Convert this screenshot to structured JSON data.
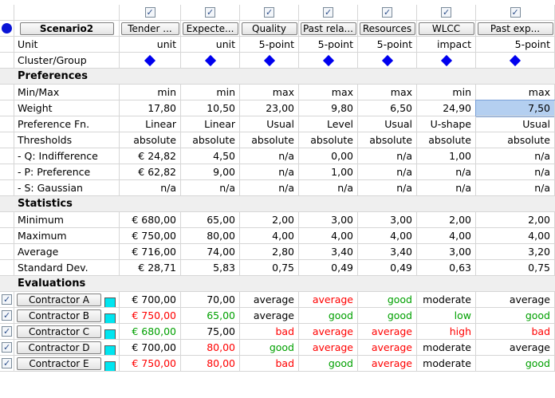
{
  "scenario": {
    "label": "Scenario2"
  },
  "criteria": [
    {
      "label": "Tender ...",
      "unit": "unit"
    },
    {
      "label": "Expecte...",
      "unit": "unit"
    },
    {
      "label": "Quality",
      "unit": "5-point"
    },
    {
      "label": "Past rela...",
      "unit": "5-point"
    },
    {
      "label": "Resources",
      "unit": "5-point"
    },
    {
      "label": "WLCC",
      "unit": "impact"
    },
    {
      "label": "Past exp...",
      "unit": "5-point"
    }
  ],
  "row_labels": {
    "unit": "Unit",
    "cluster": "Cluster/Group",
    "preferences": "Preferences",
    "minmax": "Min/Max",
    "weight": "Weight",
    "pref_fn": "Preference Fn.",
    "thresholds": "Thresholds",
    "q": "- Q: Indifference",
    "p": "- P: Preference",
    "s": "- S: Gaussian",
    "statistics": "Statistics",
    "minimum": "Minimum",
    "maximum": "Maximum",
    "average": "Average",
    "std": "Standard Dev.",
    "evaluations": "Evaluations"
  },
  "preferences": {
    "minmax": [
      "min",
      "min",
      "max",
      "max",
      "max",
      "min",
      "max"
    ],
    "weight": [
      "17,80",
      "10,50",
      "23,00",
      "9,80",
      "6,50",
      "24,90",
      "7,50"
    ],
    "pref_fn": [
      "Linear",
      "Linear",
      "Usual",
      "Level",
      "Usual",
      "U-shape",
      "Usual"
    ],
    "thresholds": [
      "absolute",
      "absolute",
      "absolute",
      "absolute",
      "absolute",
      "absolute",
      "absolute"
    ],
    "q": [
      "€ 24,82",
      "4,50",
      "n/a",
      "0,00",
      "n/a",
      "1,00",
      "n/a"
    ],
    "p": [
      "€ 62,82",
      "9,00",
      "n/a",
      "1,00",
      "n/a",
      "n/a",
      "n/a"
    ],
    "s": [
      "n/a",
      "n/a",
      "n/a",
      "n/a",
      "n/a",
      "n/a",
      "n/a"
    ]
  },
  "statistics": {
    "minimum": [
      "€ 680,00",
      "65,00",
      "2,00",
      "3,00",
      "3,00",
      "2,00",
      "2,00"
    ],
    "maximum": [
      "€ 750,00",
      "80,00",
      "4,00",
      "4,00",
      "4,00",
      "4,00",
      "4,00"
    ],
    "average": [
      "€ 716,00",
      "74,00",
      "2,80",
      "3,40",
      "3,40",
      "3,00",
      "3,20"
    ],
    "std": [
      "€ 28,71",
      "5,83",
      "0,75",
      "0,49",
      "0,49",
      "0,63",
      "0,75"
    ]
  },
  "evaluations": [
    {
      "name": "Contractor A",
      "values": [
        "€ 700,00",
        "70,00",
        "average",
        "average",
        "good",
        "moderate",
        "average"
      ],
      "colors": [
        "blk",
        "blk",
        "blk",
        "red",
        "green",
        "blk",
        "blk"
      ]
    },
    {
      "name": "Contractor B",
      "values": [
        "€ 750,00",
        "65,00",
        "average",
        "good",
        "good",
        "low",
        "good"
      ],
      "colors": [
        "red",
        "green",
        "blk",
        "green",
        "green",
        "green",
        "green"
      ]
    },
    {
      "name": "Contractor C",
      "values": [
        "€ 680,00",
        "75,00",
        "bad",
        "average",
        "average",
        "high",
        "bad"
      ],
      "colors": [
        "green",
        "blk",
        "red",
        "red",
        "red",
        "red",
        "red"
      ]
    },
    {
      "name": "Contractor D",
      "values": [
        "€ 700,00",
        "80,00",
        "good",
        "average",
        "average",
        "moderate",
        "average"
      ],
      "colors": [
        "blk",
        "red",
        "green",
        "red",
        "red",
        "blk",
        "blk"
      ]
    },
    {
      "name": "Contractor E",
      "values": [
        "€ 750,00",
        "80,00",
        "bad",
        "good",
        "average",
        "moderate",
        "good"
      ],
      "colors": [
        "red",
        "red",
        "red",
        "green",
        "red",
        "blk",
        "green"
      ]
    }
  ],
  "colors": {
    "red": "#ff0000",
    "green": "#00a000",
    "accent_dot": "#0a14d6",
    "diamond": "#0000ee",
    "cyan_swatch": "#00e5f0",
    "selected_cell": "#b4cff0"
  }
}
